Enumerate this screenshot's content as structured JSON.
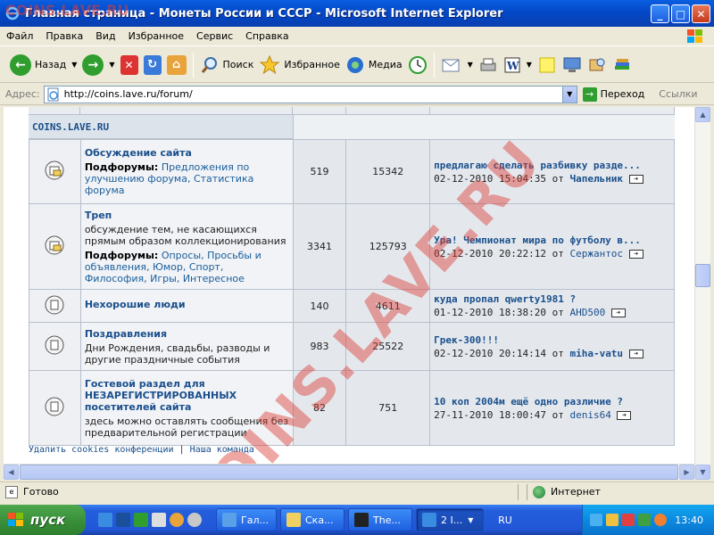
{
  "window": {
    "title": "Главная страница - Монеты России и СССР - Microsoft Internet Explorer",
    "minimize": "_",
    "maximize": "□",
    "close": "✕"
  },
  "menu": [
    "Файл",
    "Правка",
    "Вид",
    "Избранное",
    "Сервис",
    "Справка"
  ],
  "toolbar": {
    "back": "Назад",
    "search": "Поиск",
    "favorites": "Избранное",
    "media": "Медиа"
  },
  "address": {
    "label": "Адрес:",
    "url": "http://coins.lave.ru/forum/",
    "go": "Переход",
    "links": "Ссылки"
  },
  "category": "COINS.LAVE.RU",
  "forums": [
    {
      "name": "Обсуждение сайта",
      "subforums_label": "Подфорумы:",
      "subforums_text": "Предложения по улучшению форума, Статистика форума",
      "topics": "519",
      "posts": "15342",
      "last_title": "предлагаю сделать разбивку разде...",
      "last_date": "02-12-2010 15:04:35 от",
      "last_user": "Чапельник"
    },
    {
      "name": "Треп",
      "desc": "обсуждение тем, не касающихся прямым образом коллекционирования",
      "subforums_label": "Подфорумы:",
      "subforums_text": "Опросы, Просьбы и объявления, Юмор, Спорт, Философия, Игры, Интересное",
      "topics": "3341",
      "posts": "125793",
      "last_title": "Ура! Чемпионат мира по футболу в...",
      "last_date": "02-12-2010 20:22:12 от",
      "last_user": "Сержантос"
    },
    {
      "name": "Нехорошие люди",
      "topics": "140",
      "posts": "4611",
      "last_title": "куда пропал qwerty1981 ?",
      "last_date": "01-12-2010 18:38:20 от",
      "last_user": "AHD500"
    },
    {
      "name": "Поздравления",
      "desc": "Дни Рождения, свадьбы, разводы и другие праздничные события",
      "topics": "983",
      "posts": "25522",
      "last_title": "Грек-300!!!",
      "last_date": "02-12-2010 20:14:14 от",
      "last_user": "miha-vatu"
    },
    {
      "name": "Гостевой раздел для НЕЗАРЕГИСТРИРОВАННЫХ посетителей сайта",
      "desc": "здесь можно оставлять сообщения без предварительной регистрации",
      "topics": "82",
      "posts": "751",
      "last_title": "10 коп 2004м ещё одно различие ?",
      "last_date": "27-11-2010 18:00:47 от",
      "last_user": "denis64"
    }
  ],
  "footer": {
    "delete_cookies": "Удалить cookies конференции",
    "separator": "|",
    "team": "Наша команда"
  },
  "watermark": "COINS.LAVE.RU",
  "watermark_top": "COINS.LAVE.RU",
  "status": {
    "done": "Готово",
    "zone": "Интернет"
  },
  "taskbar": {
    "start": "пуск",
    "tasks": [
      "Гал...",
      "Ска...",
      "The...",
      "2 I..."
    ],
    "lang": "RU",
    "clock": "13:40"
  },
  "colors": {
    "titlebar": "#0348c8",
    "link": "#1a4f8c",
    "watermark": "#dc3c32",
    "taskbar": "#245edb",
    "start": "#3a913a"
  }
}
